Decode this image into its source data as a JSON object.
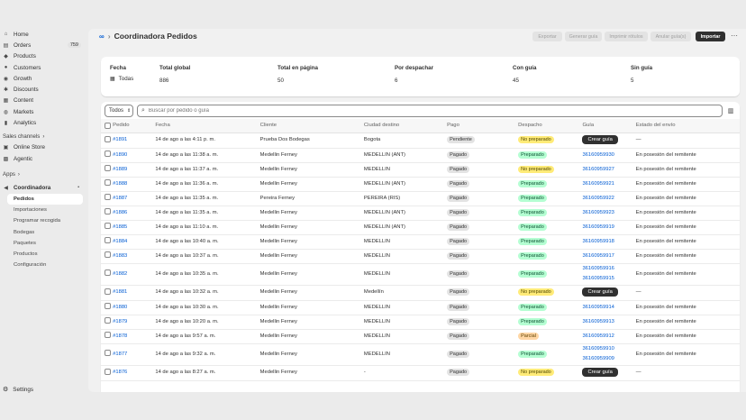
{
  "sidebar": {
    "main": [
      {
        "label": "Home",
        "icon": "home-icon",
        "glyph": "⌂"
      },
      {
        "label": "Orders",
        "icon": "orders-icon",
        "glyph": "▤",
        "badge": "759"
      },
      {
        "label": "Products",
        "icon": "tag-icon",
        "glyph": "◆"
      },
      {
        "label": "Customers",
        "icon": "person-icon",
        "glyph": "●"
      },
      {
        "label": "Growth",
        "icon": "growth-icon",
        "glyph": "◉"
      },
      {
        "label": "Discounts",
        "icon": "discount-icon",
        "glyph": "✱"
      },
      {
        "label": "Content",
        "icon": "content-icon",
        "glyph": "▦"
      },
      {
        "label": "Markets",
        "icon": "globe-icon",
        "glyph": "◍"
      },
      {
        "label": "Analytics",
        "icon": "analytics-icon",
        "glyph": "▮"
      }
    ],
    "sales_channels_label": "Sales channels",
    "channels": [
      {
        "label": "Online Store",
        "icon": "store-icon",
        "glyph": "▣"
      },
      {
        "label": "Agentic",
        "icon": "agentic-icon",
        "glyph": "▩"
      }
    ],
    "apps_label": "Apps",
    "app": {
      "label": "Coordinadora",
      "icon": "app-icon",
      "glyph": "◀"
    },
    "sub": [
      "Pedidos",
      "Importaciones",
      "Programar recogida",
      "Bodegas",
      "Paquetes",
      "Productos",
      "Configuración"
    ],
    "settings": "Settings"
  },
  "header": {
    "title": "Coordinadora Pedidos",
    "buttons": [
      "Exportar",
      "Generar guía",
      "Imprimir rótulos",
      "Anular guía(s)",
      "Importar"
    ]
  },
  "summary": {
    "fecha_label": "Fecha",
    "fecha_value": "Todas",
    "stats": [
      {
        "label": "Total global",
        "value": "886"
      },
      {
        "label": "Total en página",
        "value": "50"
      },
      {
        "label": "Por despachar",
        "value": "6"
      },
      {
        "label": "Con guía",
        "value": "45"
      },
      {
        "label": "Sin guía",
        "value": "5"
      }
    ]
  },
  "filters": {
    "select": "Todos",
    "search_placeholder": "Buscar por pedido o guía"
  },
  "columns": [
    "Pedido",
    "Fecha",
    "Cliente",
    "Ciudad destino",
    "Pago",
    "Despacho",
    "Guía",
    "Estado del envío"
  ],
  "rows": [
    {
      "pedido": "#1891",
      "fecha": "14 de ago a las 4:11 p. m.",
      "cliente": "Prueba Dos Bodegas",
      "ciudad": "Bogota",
      "pago": "Pendiente",
      "despacho": "No preparado",
      "guias": [],
      "estado": "—"
    },
    {
      "pedido": "#1890",
      "fecha": "14 de ago a las 11:38 a. m.",
      "cliente": "Medellin Ferney",
      "ciudad": "MEDELLIN (ANT)",
      "pago": "Pagado",
      "despacho": "Preparado",
      "guias": [
        "36160959930"
      ],
      "estado": "En posesión del remitente"
    },
    {
      "pedido": "#1889",
      "fecha": "14 de ago a las 11:37 a. m.",
      "cliente": "Medellin Ferney",
      "ciudad": "MEDELLIN",
      "pago": "Pagado",
      "despacho": "No preparado",
      "guias": [
        "36160959927"
      ],
      "estado": "En posesión del remitente"
    },
    {
      "pedido": "#1888",
      "fecha": "14 de ago a las 11:36 a. m.",
      "cliente": "Medellin Ferney",
      "ciudad": "MEDELLIN (ANT)",
      "pago": "Pagado",
      "despacho": "Preparado",
      "guias": [
        "36160959921"
      ],
      "estado": "En posesión del remitente"
    },
    {
      "pedido": "#1887",
      "fecha": "14 de ago a las 11:35 a. m.",
      "cliente": "Pereira Ferney",
      "ciudad": "PEREIRA (RIS)",
      "pago": "Pagado",
      "despacho": "Preparado",
      "guias": [
        "36160959922"
      ],
      "estado": "En posesión del remitente"
    },
    {
      "pedido": "#1886",
      "fecha": "14 de ago a las 11:35 a. m.",
      "cliente": "Medellin Ferney",
      "ciudad": "MEDELLIN (ANT)",
      "pago": "Pagado",
      "despacho": "Preparado",
      "guias": [
        "36160959923"
      ],
      "estado": "En posesión del remitente"
    },
    {
      "pedido": "#1885",
      "fecha": "14 de ago a las 11:10 a. m.",
      "cliente": "Medellin Ferney",
      "ciudad": "MEDELLIN (ANT)",
      "pago": "Pagado",
      "despacho": "Preparado",
      "guias": [
        "36160959919"
      ],
      "estado": "En posesión del remitente"
    },
    {
      "pedido": "#1884",
      "fecha": "14 de ago a las 10:40 a. m.",
      "cliente": "Medellin Ferney",
      "ciudad": "MEDELLIN",
      "pago": "Pagado",
      "despacho": "Preparado",
      "guias": [
        "36160959918"
      ],
      "estado": "En posesión del remitente"
    },
    {
      "pedido": "#1883",
      "fecha": "14 de ago a las 10:37 a. m.",
      "cliente": "Medellin Ferney",
      "ciudad": "MEDELLIN",
      "pago": "Pagado",
      "despacho": "Preparado",
      "guias": [
        "36160959917"
      ],
      "estado": "En posesión del remitente"
    },
    {
      "pedido": "#1882",
      "fecha": "14 de ago a las 10:35 a. m.",
      "cliente": "Medellin Ferney",
      "ciudad": "MEDELLIN",
      "pago": "Pagado",
      "despacho": "Preparado",
      "guias": [
        "36160959916",
        "36160959915"
      ],
      "estado": "En posesión del remitente"
    },
    {
      "pedido": "#1881",
      "fecha": "14 de ago a las 10:32 a. m.",
      "cliente": "Medellin Ferney",
      "ciudad": "Medellín",
      "pago": "Pagado",
      "despacho": "No preparado",
      "guias": [],
      "estado": "—"
    },
    {
      "pedido": "#1880",
      "fecha": "14 de ago a las 10:30 a. m.",
      "cliente": "Medellin Ferney",
      "ciudad": "MEDELLIN",
      "pago": "Pagado",
      "despacho": "Preparado",
      "guias": [
        "36160959914"
      ],
      "estado": "En posesión del remitente"
    },
    {
      "pedido": "#1879",
      "fecha": "14 de ago a las 10:20 a. m.",
      "cliente": "Medellin Ferney",
      "ciudad": "MEDELLIN",
      "pago": "Pagado",
      "despacho": "Preparado",
      "guias": [
        "36160959913"
      ],
      "estado": "En posesión del remitente"
    },
    {
      "pedido": "#1878",
      "fecha": "14 de ago a las 9:57 a. m.",
      "cliente": "Medellin Ferney",
      "ciudad": "MEDELLIN",
      "pago": "Pagado",
      "despacho": "Parcial",
      "guias": [
        "36160959912"
      ],
      "estado": "En posesión del remitente"
    },
    {
      "pedido": "#1877",
      "fecha": "14 de ago a las 9:32 a. m.",
      "cliente": "Medellin Ferney",
      "ciudad": "MEDELLIN",
      "pago": "Pagado",
      "despacho": "Preparado",
      "guias": [
        "36160959910",
        "36160959909"
      ],
      "estado": "En posesión del remitente"
    },
    {
      "pedido": "#1876",
      "fecha": "14 de ago a las 8:27 a. m.",
      "cliente": "Medellin Ferney",
      "ciudad": "-",
      "pago": "Pagado",
      "despacho": "No preparado",
      "guias": [],
      "estado": "—"
    }
  ],
  "crear_guia_label": "Crear guía",
  "status_colors": {
    "Preparado": "green",
    "No preparado": "yellow",
    "Parcial": "orange",
    "Pagado": "grey",
    "Pendiente": "grey"
  }
}
